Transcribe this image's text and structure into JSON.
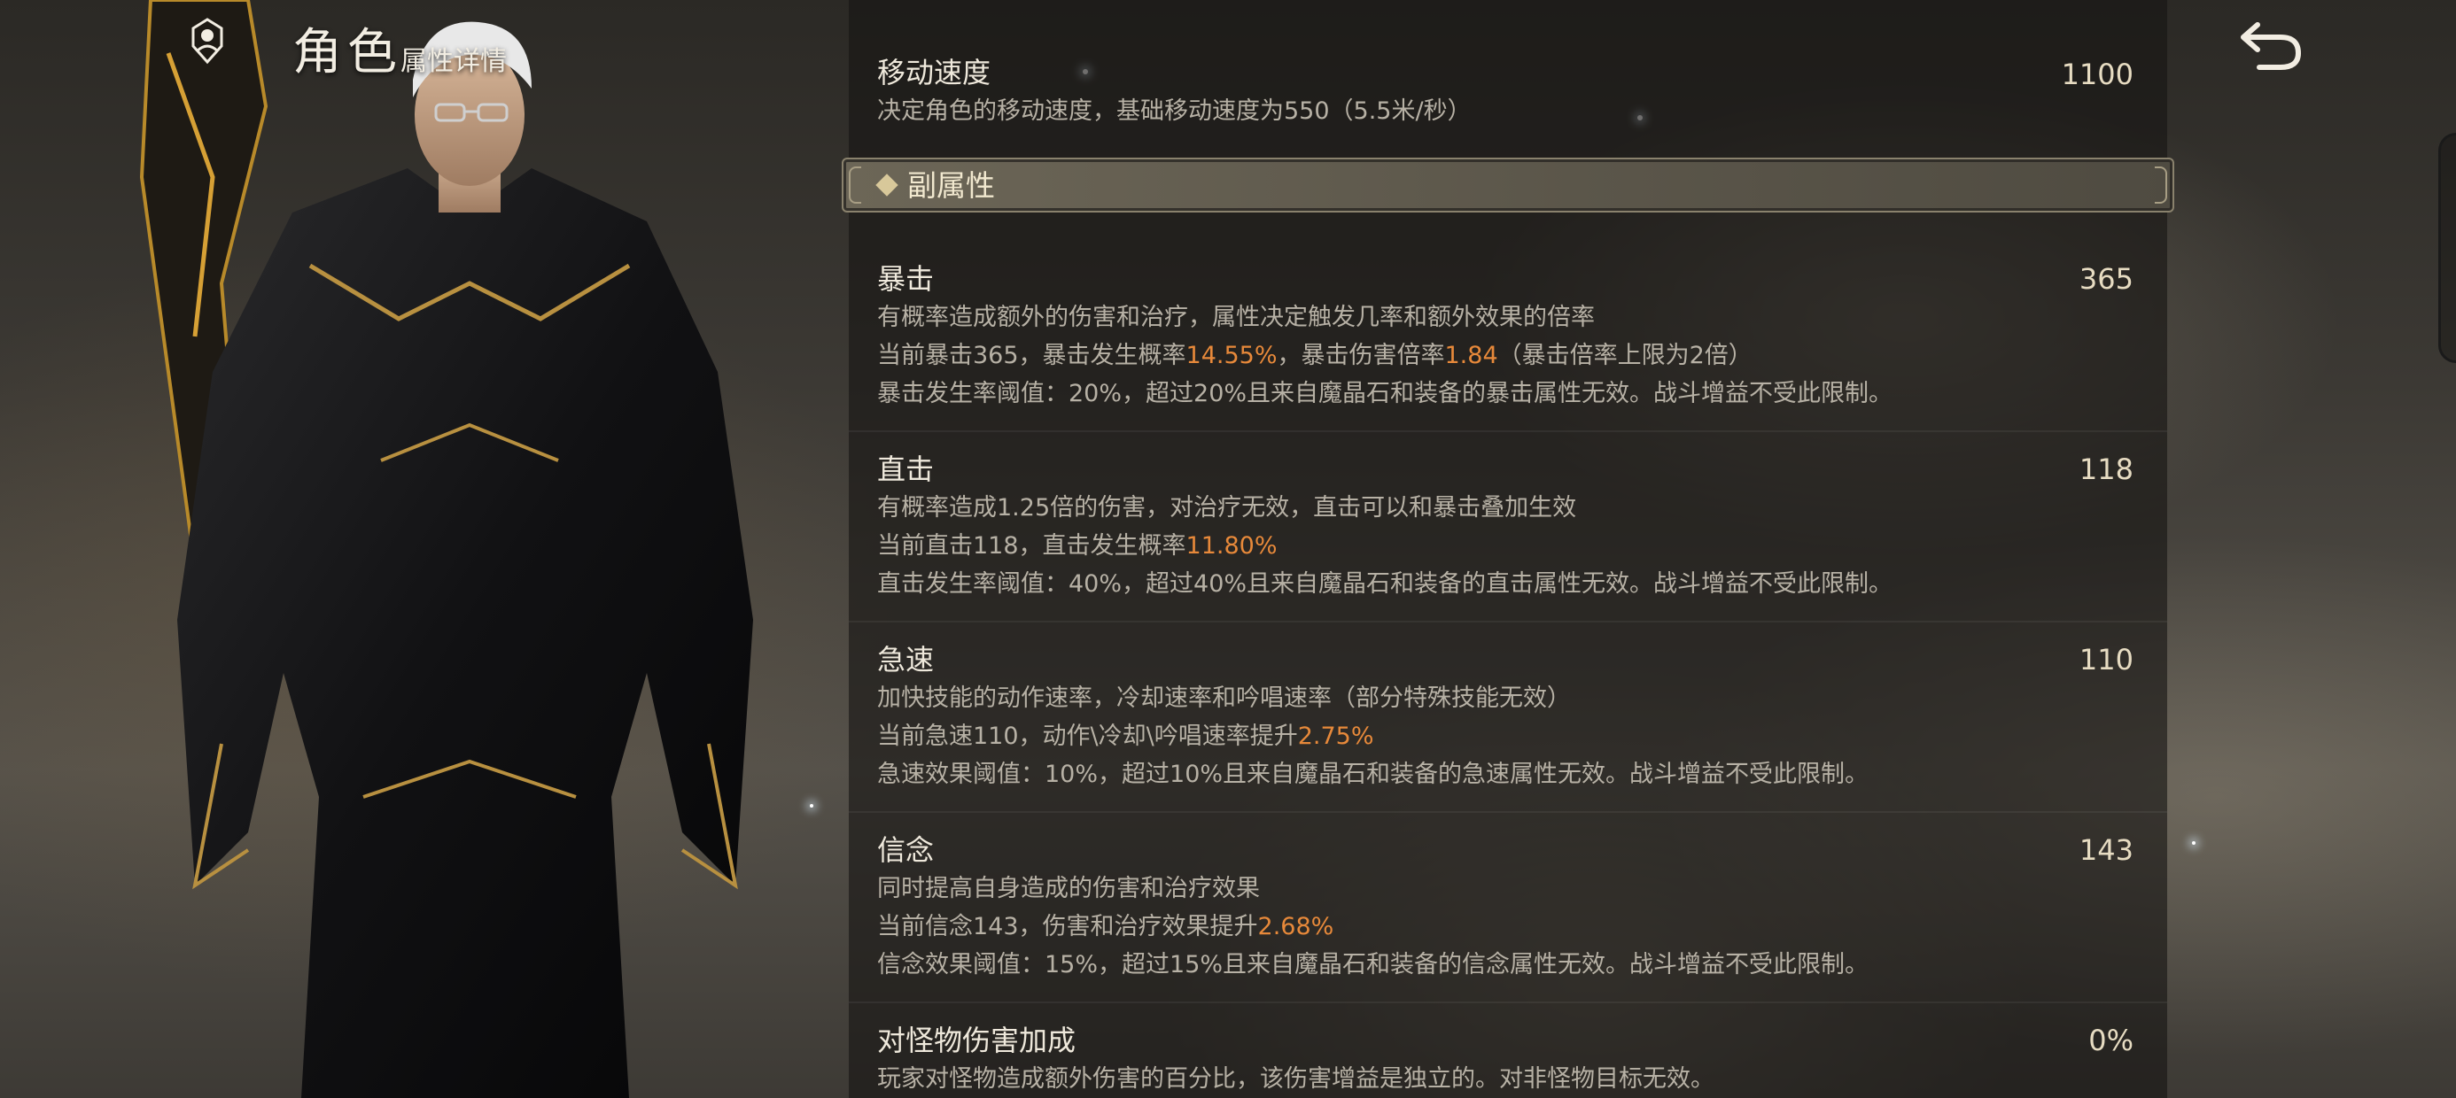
{
  "header": {
    "title": "角色",
    "subtitle": "属性详情"
  },
  "move_speed": {
    "name": "移动速度",
    "value": "1100",
    "desc": "决定角色的移动速度，基础移动速度为550（5.5米/秒）"
  },
  "section": {
    "title": "副属性"
  },
  "crit": {
    "name": "暴击",
    "value": "365",
    "desc": "有概率造成额外的伤害和治疗，属性决定触发几率和额外效果的倍率",
    "current_a": "当前暴击365，暴击发生概率",
    "rate": "14.55%",
    "current_b": "，暴击伤害倍率",
    "mult": "1.84",
    "current_c": "（暴击倍率上限为2倍）",
    "threshold": "暴击发生率阈值：20%，超过20%且来自魔晶石和装备的暴击属性无效。战斗增益不受此限制。"
  },
  "direct": {
    "name": "直击",
    "value": "118",
    "desc": "有概率造成1.25倍的伤害，对治疗无效，直击可以和暴击叠加生效",
    "current_a": "当前直击118，直击发生概率",
    "rate": "11.80%",
    "threshold": "直击发生率阈值：40%，超过40%且来自魔晶石和装备的直击属性无效。战斗增益不受此限制。"
  },
  "haste": {
    "name": "急速",
    "value": "110",
    "desc": "加快技能的动作速率，冷却速率和吟唱速率（部分特殊技能无效）",
    "current_a": "当前急速110，动作\\冷却\\吟唱速率提升",
    "rate": "2.75%",
    "threshold": "急速效果阈值：10%，超过10%且来自魔晶石和装备的急速属性无效。战斗增益不受此限制。"
  },
  "faith": {
    "name": "信念",
    "value": "143",
    "desc": "同时提高自身造成的伤害和治疗效果",
    "current_a": "当前信念143，伤害和治疗效果提升",
    "rate": "2.68%",
    "threshold": "信念效果阈值：15%，超过15%且来自魔晶石和装备的信念属性无效。战斗增益不受此限制。"
  },
  "monster": {
    "name": "对怪物伤害加成",
    "value": "0%",
    "desc": "玩家对怪物造成额外伤害的百分比，该伤害增益是独立的。对非怪物目标无效。"
  },
  "colors": {
    "highlight": "#e7893a",
    "value_text": "#e7dcc2",
    "desc_text": "#b7b1a5"
  },
  "icons": [
    "role-emblem-icon",
    "back-arrow-icon",
    "diamond-icon"
  ]
}
